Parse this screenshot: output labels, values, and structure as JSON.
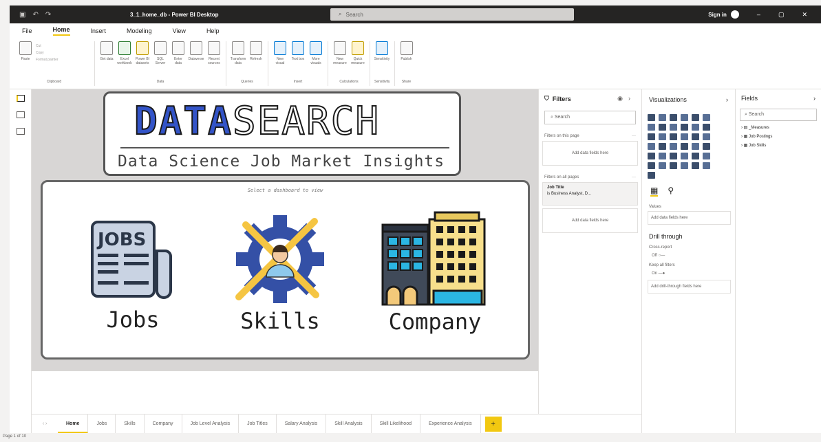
{
  "window": {
    "title": "3_1_home_db - Power BI Desktop",
    "search_placeholder": "Search",
    "signin": "Sign in"
  },
  "menu": [
    "File",
    "Home",
    "Insert",
    "Modeling",
    "View",
    "Help"
  ],
  "ribbon": {
    "clipboard": {
      "paste": "Paste",
      "cut": "Cut",
      "copy": "Copy",
      "format_painter": "Format painter",
      "label": "Clipboard"
    },
    "data": {
      "buttons": [
        "Get data",
        "Excel workbook",
        "Power BI datasets",
        "SQL Server",
        "Enter data",
        "Dataverse",
        "Recent sources"
      ],
      "label": "Data"
    },
    "queries": {
      "buttons": [
        "Transform data",
        "Refresh"
      ],
      "label": "Queries"
    },
    "insert": {
      "buttons": [
        "New visual",
        "Text box",
        "More visuals"
      ],
      "label": "Insert"
    },
    "calculations": {
      "buttons": [
        "New measure",
        "Quick measure"
      ],
      "label": "Calculations"
    },
    "sensitivity": {
      "buttons": [
        "Sensitivity"
      ],
      "label": "Sensitivity"
    },
    "share": {
      "buttons": [
        "Publish"
      ],
      "label": "Share"
    }
  },
  "report": {
    "logo_data": "DATA",
    "logo_search": "SEARCH",
    "subtitle": "Data Science Job Market Insights",
    "hint": "Select a dashboard to view",
    "tiles": [
      "Jobs",
      "Skills",
      "Company"
    ],
    "jobs_icon_text": "JOBS"
  },
  "filters": {
    "title": "Filters",
    "search": "Search",
    "this_page": "Filters on this page",
    "add_here": "Add data fields here",
    "all_pages": "Filters on all pages",
    "card_title": "Job Title",
    "card_value": "is Business Analyst, D..."
  },
  "viz": {
    "title": "Visualizations",
    "values": "Values",
    "add_here": "Add data fields here",
    "drill": "Drill through",
    "cross": "Cross-report",
    "off": "Off",
    "keep": "Keep all filters",
    "on": "On",
    "drill_add": "Add drill-through fields here"
  },
  "fields": {
    "title": "Fields",
    "search": "Search",
    "items": [
      "_Measures",
      "Job Postings",
      "Job Skills"
    ]
  },
  "pages": [
    "Home",
    "Jobs",
    "Skills",
    "Company",
    "Job Level Analysis",
    "Job Titles",
    "Salary Analysis",
    "Skill Analysis",
    "Skill Likelihood",
    "Experience Analysis"
  ],
  "status": "Page 1 of 10",
  "colors": {
    "accent": "#f2c811",
    "logo_blue": "#3354c8",
    "gear_blue": "#3450a6",
    "wrench_yellow": "#f5c542"
  }
}
